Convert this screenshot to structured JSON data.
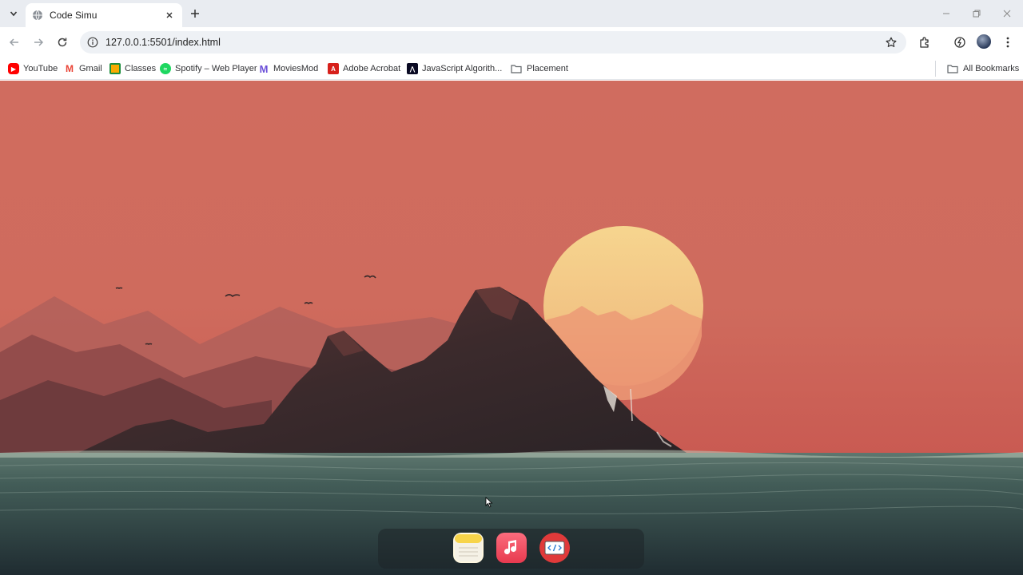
{
  "browser": {
    "tab": {
      "title": "Code Simu"
    },
    "address_bar": {
      "url": "127.0.0.1:5501/index.html"
    },
    "bookmarks": [
      {
        "label": "YouTube",
        "icon": "youtube-icon",
        "color": "#ff0000"
      },
      {
        "label": "Gmail",
        "icon": "gmail-icon",
        "color": "#ea4335"
      },
      {
        "label": "Classes",
        "icon": "classroom-icon",
        "color": "#1e8e3e"
      },
      {
        "label": "Spotify – Web Player",
        "icon": "spotify-icon",
        "color": "#1ed760"
      },
      {
        "label": "MoviesMod",
        "icon": "moviesmod-icon",
        "color": "#6b4fd8"
      },
      {
        "label": "Adobe Acrobat",
        "icon": "acrobat-icon",
        "color": "#d7201b"
      },
      {
        "label": "JavaScript Algorith...",
        "icon": "freecodecamp-icon",
        "color": "#0a0a23"
      },
      {
        "label": "Placement",
        "icon": "folder-icon",
        "color": "#5f6368"
      }
    ],
    "all_bookmarks": {
      "label": "All Bookmarks",
      "icon": "folder-icon"
    }
  },
  "page": {
    "wallpaper": "sunset-mountains-sea",
    "colors": {
      "sky": "#cf6b5e",
      "sun": "#f5d28a",
      "sea": "#3c5552",
      "mountain": "#3b2a2c"
    },
    "dock": {
      "apps": [
        {
          "name": "notes-app-icon",
          "color": "#f7d44a"
        },
        {
          "name": "music-app-icon",
          "color": "#f5455c"
        },
        {
          "name": "code-editor-app-icon",
          "color": "#e03a3a"
        }
      ]
    }
  }
}
